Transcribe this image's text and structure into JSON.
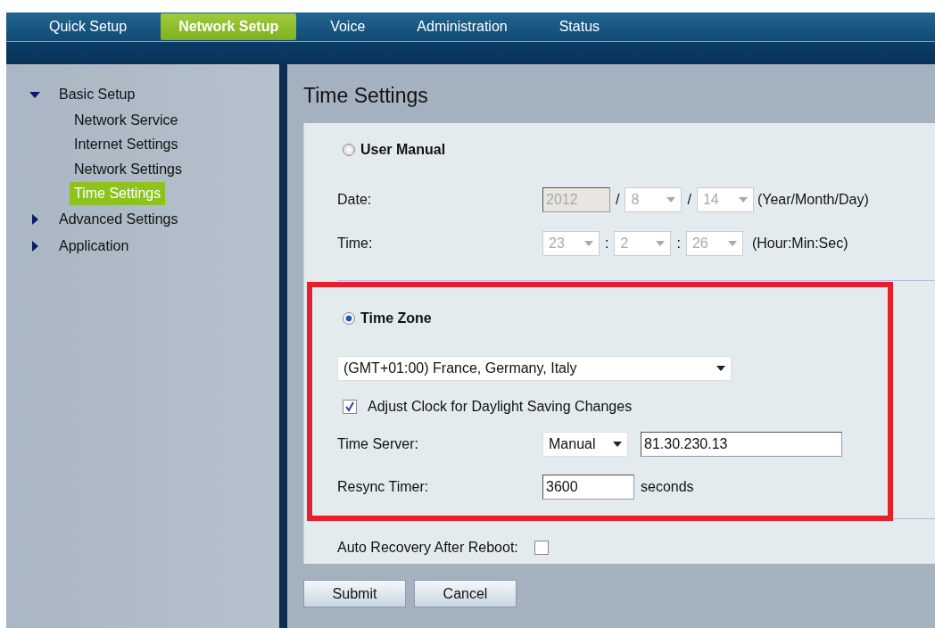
{
  "nav": {
    "tabs": [
      {
        "label": "Quick Setup",
        "selected": false
      },
      {
        "label": "Network Setup",
        "selected": true
      },
      {
        "label": "Voice",
        "selected": false
      },
      {
        "label": "Administration",
        "selected": false
      },
      {
        "label": "Status",
        "selected": false
      }
    ]
  },
  "sidebar": {
    "items": [
      {
        "label": "Basic Setup",
        "expanded": true,
        "children": [
          {
            "label": "Network Service",
            "selected": false
          },
          {
            "label": "Internet Settings",
            "selected": false
          },
          {
            "label": "Network Settings",
            "selected": false
          },
          {
            "label": "Time Settings",
            "selected": true
          }
        ]
      },
      {
        "label": "Advanced Settings",
        "expanded": false
      },
      {
        "label": "Application",
        "expanded": false
      }
    ]
  },
  "page_title": "Time Settings",
  "user_manual": {
    "label": "User Manual",
    "selected": false,
    "disabled": true,
    "date": {
      "label": "Date:",
      "parts": [
        {
          "kind": "input",
          "value": "2012"
        },
        {
          "kind": "sep",
          "text": "/"
        },
        {
          "kind": "select",
          "value": "8"
        },
        {
          "kind": "sep",
          "text": "/"
        },
        {
          "kind": "select",
          "value": "14"
        },
        {
          "kind": "hint",
          "text": "(Year/Month/Day)"
        }
      ]
    },
    "time": {
      "label": "Time:",
      "parts": [
        {
          "kind": "select",
          "value": "23"
        },
        {
          "kind": "sep",
          "text": ":"
        },
        {
          "kind": "select",
          "value": "2"
        },
        {
          "kind": "sep",
          "text": ":"
        },
        {
          "kind": "select",
          "value": "26"
        },
        {
          "kind": "hint",
          "text": "(Hour:Min:Sec)"
        }
      ]
    }
  },
  "time_zone": {
    "label": "Time Zone",
    "selected": true,
    "zone": "(GMT+01:00) France, Germany, Italy",
    "dst": {
      "label": "Adjust Clock for Daylight Saving Changes",
      "checked": true
    },
    "server": {
      "label": "Time Server:",
      "mode": "Manual",
      "address": "81.30.230.13"
    },
    "resync": {
      "label": "Resync Timer:",
      "value": "3600",
      "unit": "seconds"
    }
  },
  "auto_recovery": {
    "label": "Auto Recovery After Reboot:",
    "checked": false
  },
  "buttons": [
    "Submit",
    "Cancel"
  ],
  "highlight_frame": true
}
